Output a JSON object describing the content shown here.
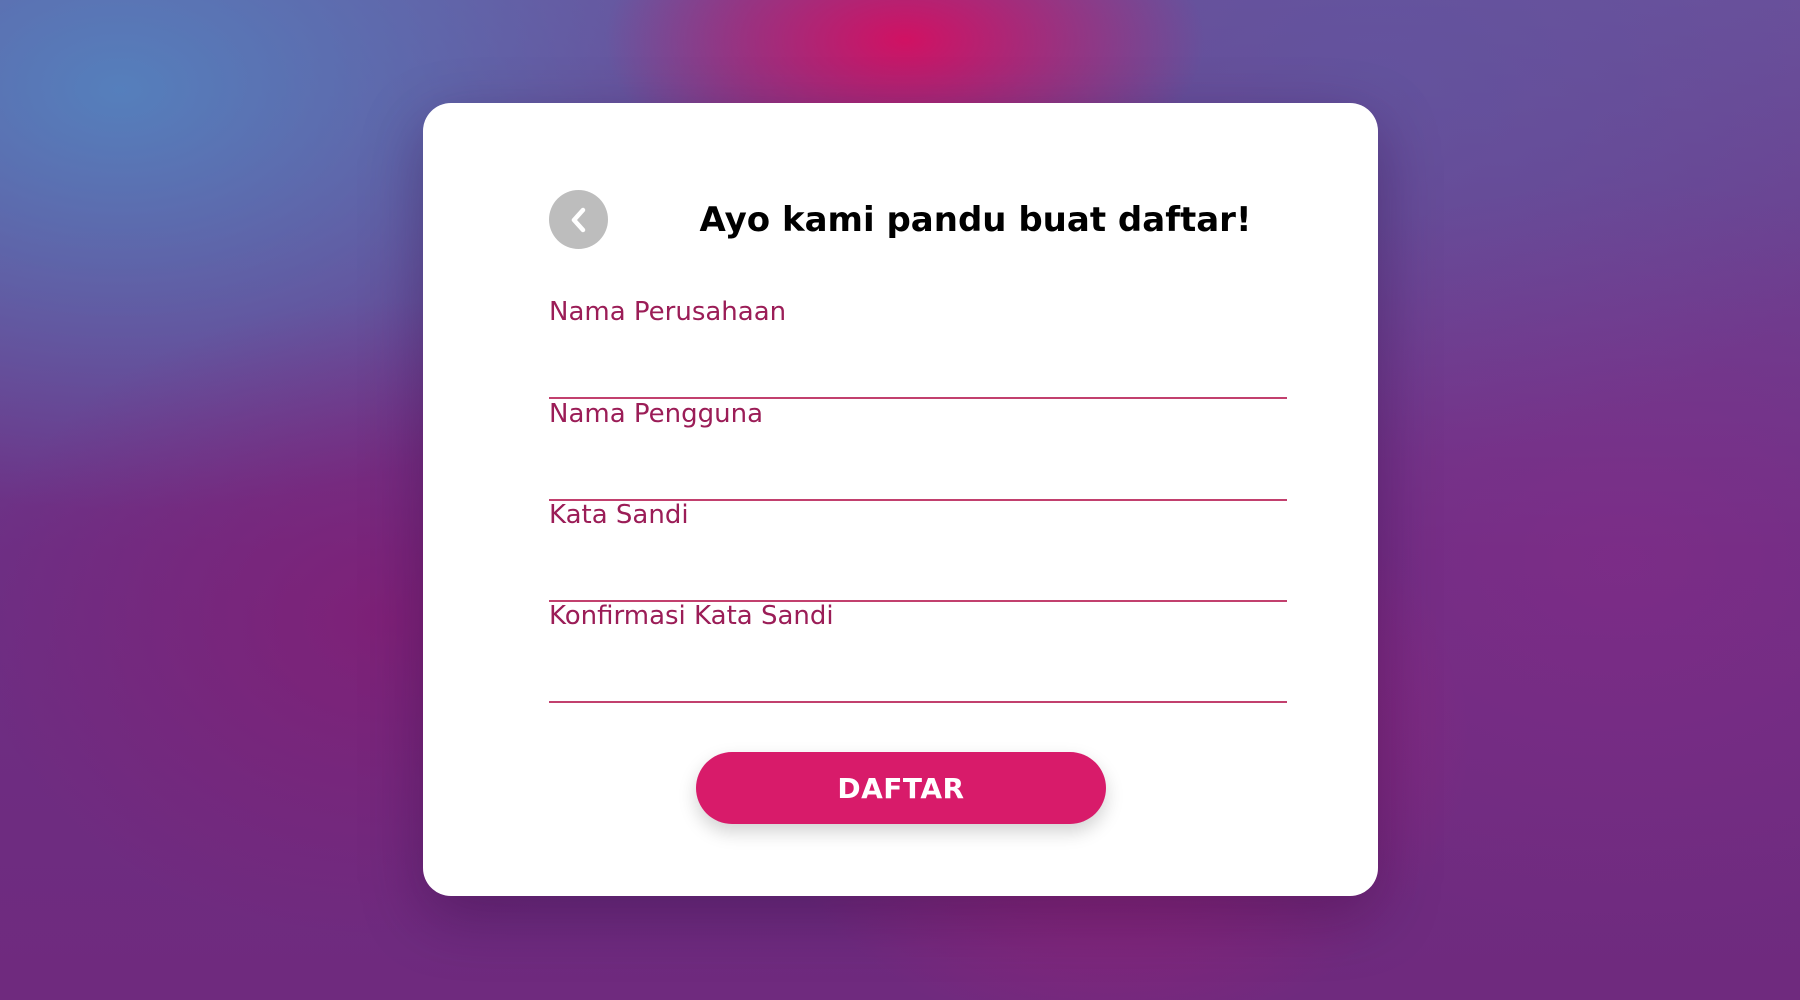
{
  "form": {
    "title": "Ayo kami pandu buat daftar!",
    "back_icon": "chevron-left-icon",
    "fields": [
      {
        "label": "Nama Perusahaan",
        "value": "",
        "placeholder": ""
      },
      {
        "label": "Nama Pengguna",
        "value": "",
        "placeholder": ""
      },
      {
        "label": "Kata Sandi",
        "value": "",
        "placeholder": ""
      },
      {
        "label": "Konfirmasi Kata Sandi",
        "value": "",
        "placeholder": ""
      }
    ],
    "submit_label": "DAFTAR"
  },
  "colors": {
    "accent": "#d81b6a",
    "label": "#9b1d57",
    "underline": "#c2406e",
    "back_button": "#bdbdbd",
    "card": "#ffffff"
  }
}
